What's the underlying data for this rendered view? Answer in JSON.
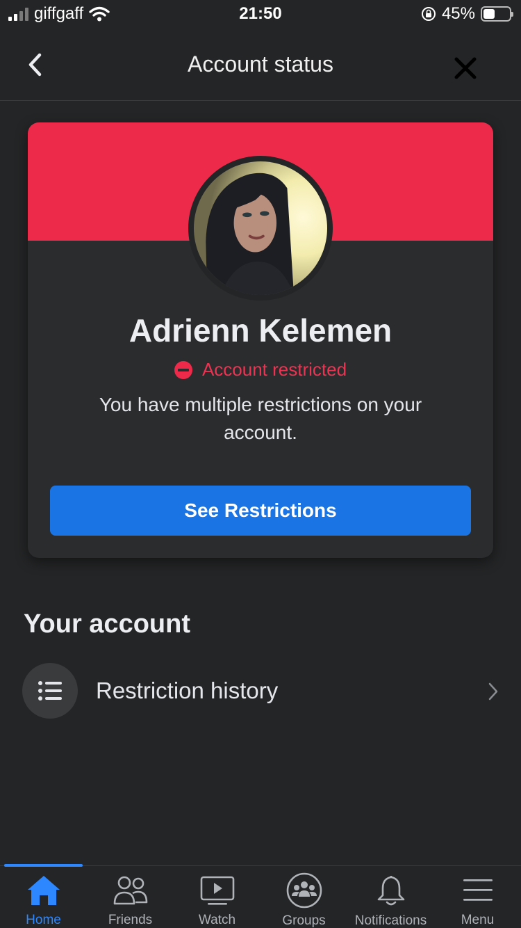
{
  "status_bar": {
    "carrier": "giffgaff",
    "time": "21:50",
    "battery": "45%",
    "battery_level": 0.45,
    "icons": [
      "signal-icon",
      "wifi-icon",
      "rotation-lock-icon",
      "battery-icon"
    ]
  },
  "header": {
    "title": "Account status",
    "back_icon": "back-chevron-icon",
    "close_icon": "close-icon"
  },
  "card": {
    "banner_color": "#ee2a4b",
    "user_name": "Adrienn Kelemen",
    "status_label": "Account restricted",
    "status_icon": "restricted-icon",
    "status_color": "#ee3352",
    "description": "You have multiple restrictions on your account.",
    "button_label": "See Restrictions",
    "button_color": "#1b74e4"
  },
  "your_account": {
    "heading": "Your account",
    "items": [
      {
        "label": "Restriction history",
        "icon": "list-icon"
      }
    ]
  },
  "bottom_nav": {
    "accent": "#2d88ff",
    "active": "Home",
    "items": [
      {
        "label": "Home",
        "icon": "home-icon"
      },
      {
        "label": "Friends",
        "icon": "friends-icon"
      },
      {
        "label": "Watch",
        "icon": "watch-icon"
      },
      {
        "label": "Groups",
        "icon": "groups-icon"
      },
      {
        "label": "Notifications",
        "icon": "bell-icon"
      },
      {
        "label": "Menu",
        "icon": "menu-icon"
      }
    ]
  }
}
